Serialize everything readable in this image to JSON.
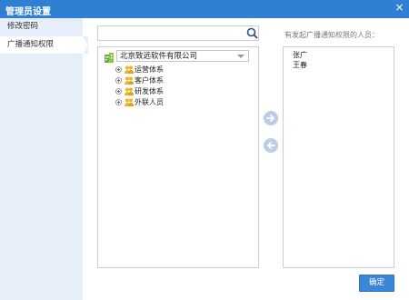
{
  "window": {
    "title": "管理员设置",
    "close_glyph": "×"
  },
  "sidebar": {
    "items": [
      {
        "label": "修改密码",
        "active": false
      },
      {
        "label": "广播通知权限",
        "active": true
      }
    ]
  },
  "search": {
    "value": "",
    "placeholder": "",
    "icon": "search-icon"
  },
  "org_tree": {
    "root_icon": "building-icon",
    "selected_org": "北京致远软件有限公司",
    "nodes": [
      {
        "label": "运营体系",
        "icon": "group-icon",
        "expandable": true
      },
      {
        "label": "客户体系",
        "icon": "group-icon",
        "expandable": true
      },
      {
        "label": "研发体系",
        "icon": "group-icon",
        "expandable": true
      },
      {
        "label": "外联人员",
        "icon": "group-icon",
        "expandable": true
      }
    ]
  },
  "transfer": {
    "add_icon": "arrow-right-icon",
    "remove_icon": "arrow-left-icon"
  },
  "recipients": {
    "title": "有发起广播通知权限的人员：",
    "people": [
      "张广",
      "王春"
    ]
  },
  "footer": {
    "ok_label": "确定"
  },
  "colors": {
    "titlebar": "#2f7fd2",
    "sidebar_bg": "#e6eef9",
    "button": "#3a86d8",
    "arrow_button": "#b8cde6",
    "group_icon": "#f0b428",
    "org_icon": "#6aa84f"
  }
}
